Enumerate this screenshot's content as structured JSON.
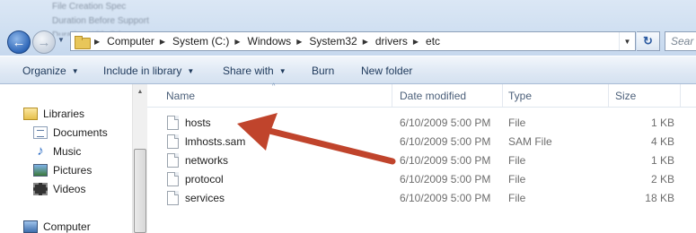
{
  "window": {
    "background_text": [
      "File Creation Spec",
      "Duration Before Support",
      "Duration With Other"
    ],
    "recent_pages_glyph": "▼"
  },
  "nav_buttons": {
    "back_glyph": "←",
    "forward_glyph": "→"
  },
  "breadcrumbs": [
    {
      "label": "Computer"
    },
    {
      "label": "System (C:)"
    },
    {
      "label": "Windows"
    },
    {
      "label": "System32"
    },
    {
      "label": "drivers"
    },
    {
      "label": "etc"
    }
  ],
  "address": {
    "dropdown_glyph": "▼",
    "refresh_glyph": "↻"
  },
  "search": {
    "placeholder": "Sear"
  },
  "toolbar": {
    "organize": "Organize",
    "include_in_library": "Include in library",
    "share_with": "Share with",
    "burn": "Burn",
    "new_folder": "New folder",
    "caret": "▼"
  },
  "sidebar": {
    "libraries": "Libraries",
    "items": [
      {
        "label": "Documents",
        "icon": "documents-icon"
      },
      {
        "label": "Music",
        "icon": "music-icon"
      },
      {
        "label": "Pictures",
        "icon": "pictures-icon"
      },
      {
        "label": "Videos",
        "icon": "videos-icon"
      }
    ],
    "computer": "Computer",
    "scroll_up_glyph": "▲"
  },
  "file_list": {
    "columns": {
      "name": "Name",
      "date": "Date modified",
      "type": "Type",
      "size": "Size"
    },
    "sort_glyph": "^",
    "rows": [
      {
        "name": "hosts",
        "date": "6/10/2009 5:00 PM",
        "type": "File",
        "size": "1 KB"
      },
      {
        "name": "lmhosts.sam",
        "date": "6/10/2009 5:00 PM",
        "type": "SAM File",
        "size": "4 KB"
      },
      {
        "name": "networks",
        "date": "6/10/2009 5:00 PM",
        "type": "File",
        "size": "1 KB"
      },
      {
        "name": "protocol",
        "date": "6/10/2009 5:00 PM",
        "type": "File",
        "size": "2 KB"
      },
      {
        "name": "services",
        "date": "6/10/2009 5:00 PM",
        "type": "File",
        "size": "18 KB"
      }
    ]
  },
  "annotation": {
    "arrow_color": "#c0442c",
    "target": "hosts"
  }
}
